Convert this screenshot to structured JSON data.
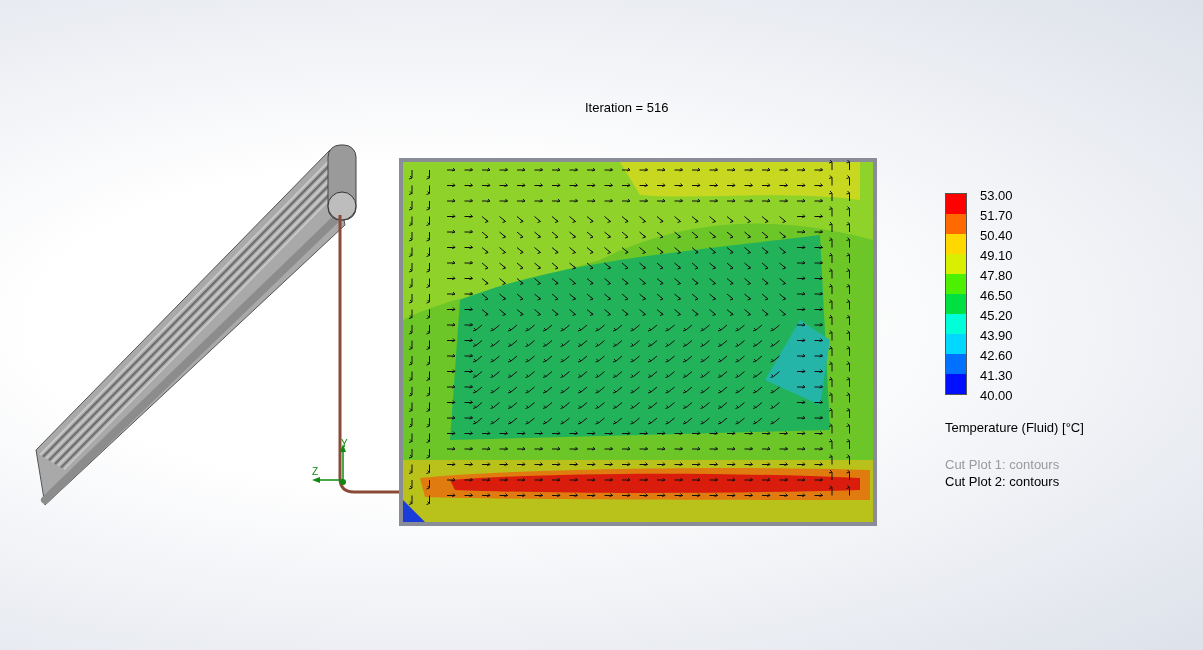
{
  "viewport": {
    "title": "Iteration = 516",
    "axes": {
      "y": "Y",
      "z": "Z"
    }
  },
  "legend": {
    "labels": [
      "53.00",
      "51.70",
      "50.40",
      "49.10",
      "47.80",
      "46.50",
      "45.20",
      "43.90",
      "42.60",
      "41.30",
      "40.00"
    ],
    "segments": [
      {
        "color": "#ff0000"
      },
      {
        "color": "#ff6a00"
      },
      {
        "color": "#ffd800"
      },
      {
        "color": "#d8f000"
      },
      {
        "color": "#4cf000"
      },
      {
        "color": "#00e040"
      },
      {
        "color": "#00ffd8"
      },
      {
        "color": "#00d8ff"
      },
      {
        "color": "#0070ff"
      },
      {
        "color": "#0010ff"
      }
    ],
    "quantity": "Temperature (Fluid) [°C]"
  },
  "plots": [
    {
      "label": "Cut Plot 1: contours",
      "active": false
    },
    {
      "label": "Cut Plot 2: contours",
      "active": true
    }
  ]
}
